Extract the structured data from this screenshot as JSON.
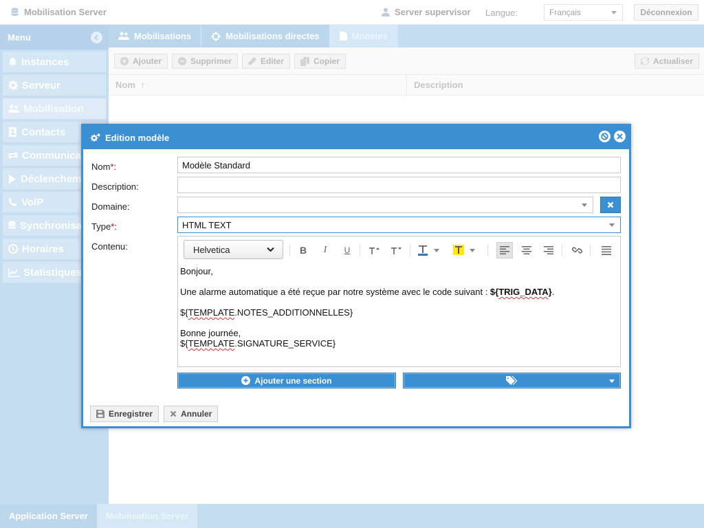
{
  "topbar": {
    "app_title": "Mobilisation Server",
    "user": "Server supervisor",
    "lang_label": "Langue:",
    "lang_value": "Français",
    "logout": "Déconnexion"
  },
  "sidebar": {
    "title": "Menu",
    "items": [
      {
        "label": "Instances",
        "icon": "bell-icon"
      },
      {
        "label": "Serveur",
        "icon": "gear-icon"
      },
      {
        "label": "Mobilisation",
        "icon": "users-icon"
      },
      {
        "label": "Contacts",
        "icon": "address-book-icon"
      },
      {
        "label": "Communications",
        "icon": "exchange-icon"
      },
      {
        "label": "Déclenchements",
        "icon": "play-icon"
      },
      {
        "label": "VoIP",
        "icon": "phone-icon"
      },
      {
        "label": "Synchronisation",
        "icon": "database-icon"
      },
      {
        "label": "Horaires",
        "icon": "clock-icon"
      },
      {
        "label": "Statistiques",
        "icon": "chart-icon"
      }
    ]
  },
  "tabs": [
    {
      "label": "Mobilisations"
    },
    {
      "label": "Mobilisations directes"
    },
    {
      "label": "Modèles"
    }
  ],
  "toolbar": {
    "add": "Ajouter",
    "delete": "Supprimer",
    "edit": "Editer",
    "copy": "Copier",
    "refresh": "Actualiser"
  },
  "grid": {
    "col_name": "Nom",
    "col_desc": "Description"
  },
  "footer": {
    "tabs": [
      "Application Server",
      "Mobilisation Server"
    ]
  },
  "modal": {
    "title": "Edition modèle",
    "labels": {
      "name": "Nom",
      "description": "Description:",
      "domain": "Domaine:",
      "type": "Type",
      "content": "Contenu:"
    },
    "required_mark": "*",
    "colon": ":",
    "name_value": "Modèle Standard",
    "description_value": "",
    "domain_value": "",
    "type_value": "HTML TEXT",
    "editor": {
      "font": "Helvetica",
      "line1": "Bonjour,",
      "line2_pre": "Une alarme automatique a été reçue par notre système avec le code suivant : ",
      "line2_var_a": "${",
      "line2_var_b": "TRIG_DATA",
      "line2_var_c": "}",
      "line2_post": ".",
      "line3_a": "${",
      "line3_b": "TEMPLATE",
      "line3_c": ".NOTES_ADDITIONNELLES}",
      "line4": "Bonne journée,",
      "line5_a": "${",
      "line5_b": "TEMPLATE",
      "line5_c": ".SIGNATURE_SERVICE}"
    },
    "add_section": "Ajouter une section",
    "save": "Enregistrer",
    "cancel": "Annuler"
  },
  "colors": {
    "accent": "#3b8fd3",
    "sidebar_bg": "#c5ddf0",
    "required": "#cc0000"
  }
}
